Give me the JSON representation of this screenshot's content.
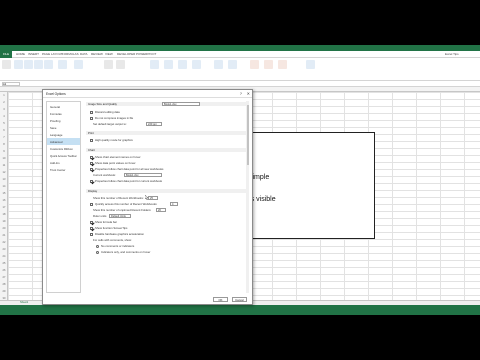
{
  "app": {
    "title": "Excel 2013 - Microsoft Excel",
    "user": "Excel Tips"
  },
  "ribbon": {
    "tabs": [
      "FILE",
      "HOME",
      "INSERT",
      "PAGE LAYOUT",
      "FORMULAS",
      "DATA",
      "REVIEW",
      "VIEW",
      "DEVELOPER",
      "POWERPIVOT"
    ],
    "groups": [
      "Clipboard",
      "Font",
      "Alignment",
      "Number",
      "Styles",
      "Cells",
      "Editing"
    ]
  },
  "formula_bar": {
    "namebox": "A1",
    "value": ""
  },
  "rows": [
    "1",
    "2",
    "3",
    "4",
    "5",
    "6",
    "7",
    "8",
    "9",
    "10",
    "11",
    "12",
    "13",
    "14",
    "15",
    "16",
    "17",
    "18",
    "19",
    "20",
    "21",
    "22",
    "23",
    "24",
    "25",
    "26",
    "27",
    "28",
    "29",
    "30"
  ],
  "sheet": {
    "tabs": [
      "Sheet1"
    ],
    "text_lines": [
      "ps",
      "simple",
      "tabs visible"
    ]
  },
  "dialog": {
    "title": "Excel Options",
    "close": "✕",
    "help": "?",
    "nav": [
      "General",
      "Formulas",
      "Proofing",
      "Save",
      "Language",
      "Advanced",
      "Customize Ribbon",
      "Quick Access Toolbar",
      "Add-Ins",
      "Trust Center"
    ],
    "selected_nav": "Advanced",
    "sections": {
      "image": {
        "header": "Image Size and Quality",
        "file_dropdown": "Book1.xlsx",
        "discard": "Discard editing data",
        "no_compress": "Do not compress images in file",
        "ppi_label": "Set default target output to:",
        "ppi_value": "220 ppi"
      },
      "print": {
        "header": "Print",
        "high_quality": "High quality mode for graphics"
      },
      "chart": {
        "header": "Chart",
        "show_names": "Show chart element names on hover",
        "show_values": "Show data point values on hover",
        "properties_follow": "Properties follow chart data point for all new workbooks",
        "current_workbook_label": "Current workbook:",
        "current_workbook_value": "Book1.xlsx",
        "properties_follow_current": "Properties follow chart data point for current workbook"
      },
      "display": {
        "header": "Display",
        "recent_workbooks": "Show this number of Recent Workbooks:",
        "recent_workbooks_value": "25",
        "quick_access": "Quickly access this number of Recent Workbooks:",
        "quick_access_value": "4",
        "unpinned_folders": "Show this number of unpinned Recent Folders:",
        "unpinned_value": "20",
        "ruler_units": "Ruler units",
        "ruler_units_value": "Default Units",
        "formula_bar": "Show formula bar",
        "function_screentips": "Show function ScreenTips",
        "disable_hw": "Disable hardware graphics acceleration",
        "comments_label": "For cells with comments, show:",
        "comments_option": "No comments or indicators",
        "indicators_only": "Indicators only, and comments on hover"
      }
    },
    "buttons": {
      "ok": "OK",
      "cancel": "Cancel"
    }
  },
  "colors": {
    "excel_green": "#217346",
    "nav_selected": "#c5e0f3"
  }
}
